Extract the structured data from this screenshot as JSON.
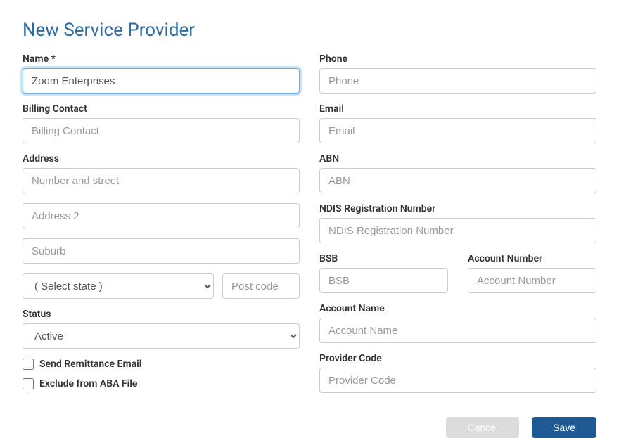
{
  "title": "New Service Provider",
  "left": {
    "name": {
      "label": "Name *",
      "value": "Zoom Enterprises",
      "placeholder": ""
    },
    "billing_contact": {
      "label": "Billing Contact",
      "placeholder": "Billing Contact"
    },
    "address": {
      "label": "Address",
      "line1_placeholder": "Number and street",
      "line2_placeholder": "Address 2",
      "suburb_placeholder": "Suburb",
      "state_placeholder": "( Select state )",
      "postcode_placeholder": "Post code"
    },
    "status": {
      "label": "Status",
      "value": "Active"
    },
    "checkbox_remittance": "Send Remittance Email",
    "checkbox_exclude_aba": "Exclude from ABA File"
  },
  "right": {
    "phone": {
      "label": "Phone",
      "placeholder": "Phone"
    },
    "email": {
      "label": "Email",
      "placeholder": "Email"
    },
    "abn": {
      "label": "ABN",
      "placeholder": "ABN"
    },
    "ndis": {
      "label": "NDIS Registration Number",
      "placeholder": "NDIS Registration Number"
    },
    "bsb": {
      "label": "BSB",
      "placeholder": "BSB"
    },
    "account_number": {
      "label": "Account Number",
      "placeholder": "Account Number"
    },
    "account_name": {
      "label": "Account Name",
      "placeholder": "Account Name"
    },
    "provider_code": {
      "label": "Provider Code",
      "placeholder": "Provider Code"
    }
  },
  "footer": {
    "cancel": "Cancel",
    "save": "Save"
  }
}
